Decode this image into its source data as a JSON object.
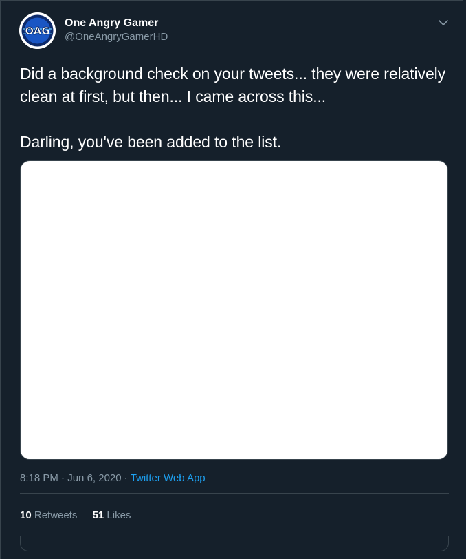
{
  "author": {
    "name": "One Angry Gamer",
    "handle": "@OneAngryGamerHD",
    "avatar_text": "OAG"
  },
  "tweet": {
    "line1": "Did a background check on your tweets... they were relatively clean at first, but then... I came across this...",
    "line2": "Darling, you've been added to the list."
  },
  "meta": {
    "time": "8:18 PM",
    "date": "Jun 6, 2020",
    "sep": "·",
    "source": "Twitter Web App"
  },
  "stats": {
    "retweets_count": "10",
    "retweets_label": "Retweets",
    "likes_count": "51",
    "likes_label": "Likes"
  },
  "colors": {
    "background": "#15202b",
    "text": "#ffffff",
    "secondary": "#8899a6",
    "link": "#1da1f2",
    "border": "#38444d"
  },
  "icons": {
    "menu": "chevron-down-icon"
  }
}
